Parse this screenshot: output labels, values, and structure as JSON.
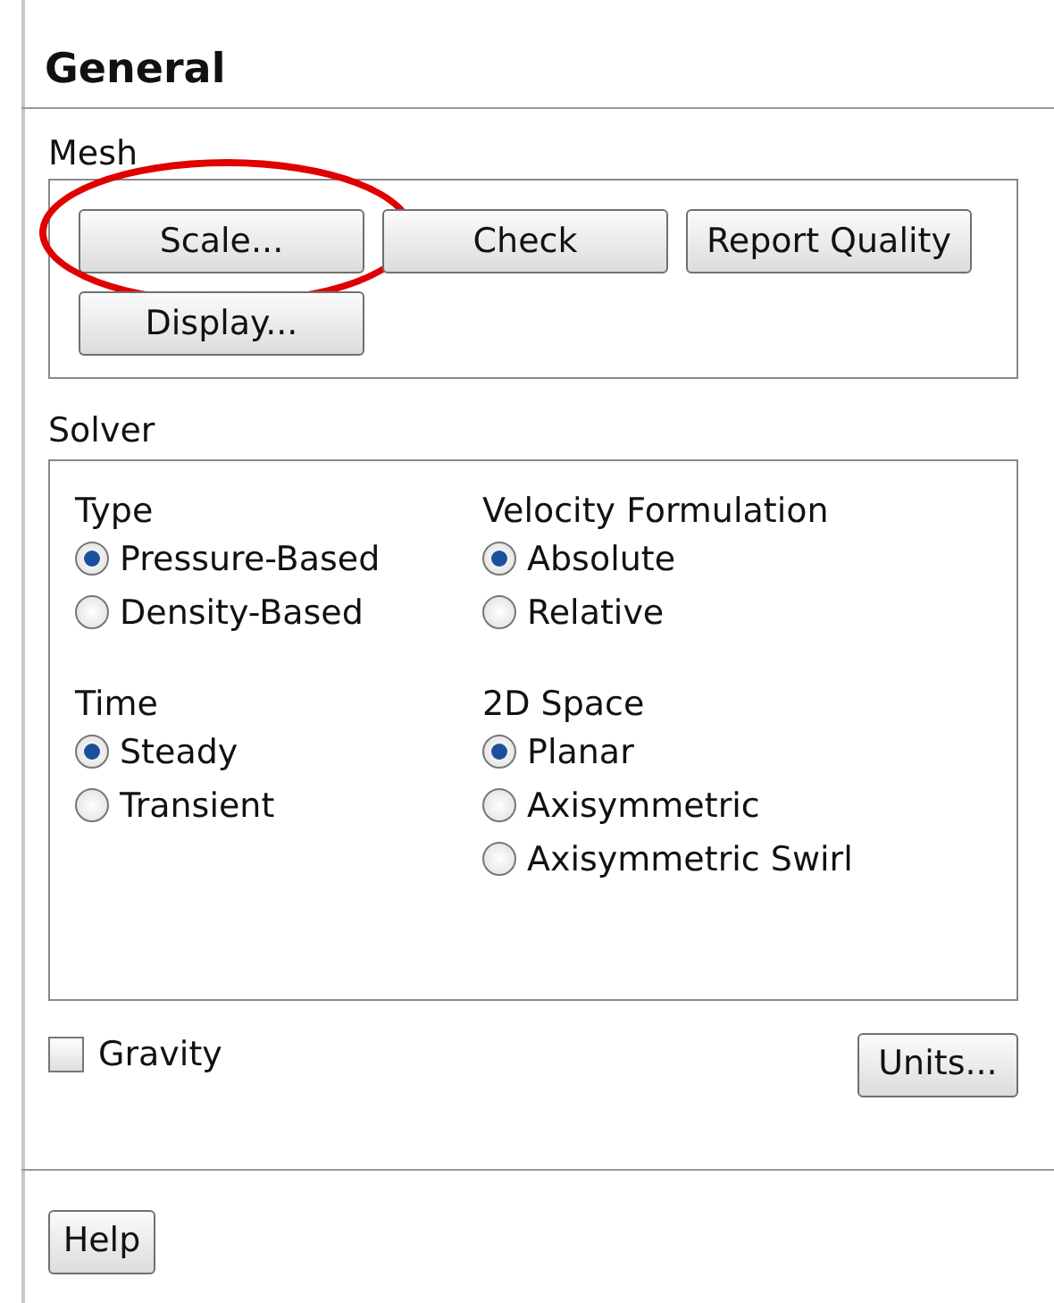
{
  "title": "General",
  "mesh": {
    "label": "Mesh",
    "buttons": [
      {
        "label": "Scale...",
        "highlighted": true
      },
      {
        "label": "Check",
        "highlighted": false
      },
      {
        "label": "Report Quality",
        "highlighted": false
      },
      {
        "label": "Display...",
        "highlighted": false
      }
    ]
  },
  "solver": {
    "label": "Solver",
    "groups": [
      {
        "label": "Type",
        "options": [
          {
            "label": "Pressure-Based",
            "selected": true
          },
          {
            "label": "Density-Based",
            "selected": false
          }
        ]
      },
      {
        "label": "Velocity Formulation",
        "options": [
          {
            "label": "Absolute",
            "selected": true
          },
          {
            "label": "Relative",
            "selected": false
          }
        ]
      },
      {
        "label": "Time",
        "options": [
          {
            "label": "Steady",
            "selected": true
          },
          {
            "label": "Transient",
            "selected": false
          }
        ]
      },
      {
        "label": "2D Space",
        "options": [
          {
            "label": "Planar",
            "selected": true
          },
          {
            "label": "Axisymmetric",
            "selected": false
          },
          {
            "label": "Axisymmetric Swirl",
            "selected": false
          }
        ]
      }
    ]
  },
  "gravity": {
    "label": "Gravity",
    "checked": false
  },
  "units_button": "Units...",
  "help_button": "Help"
}
